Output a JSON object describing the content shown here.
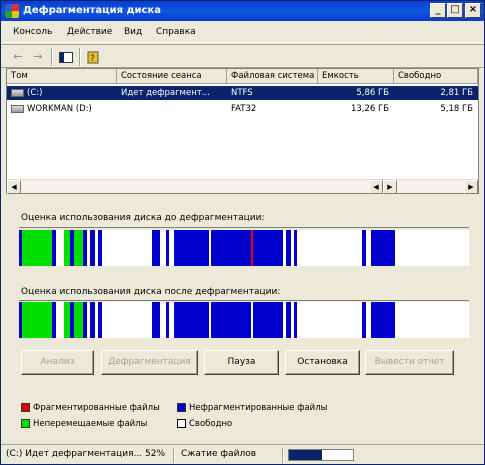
{
  "window": {
    "title": "Дефрагментация диска"
  },
  "menu": [
    "Консоль",
    "Действие",
    "Вид",
    "Справка"
  ],
  "toolbar": {
    "back_icon": "←",
    "forward_icon": "→"
  },
  "volumes": {
    "columns": [
      "Том",
      "Состояние сеанса",
      "Файловая система",
      "Емкость",
      "Свободно"
    ],
    "rows": [
      {
        "name": "(C:)",
        "status": "Идет дефрагмент...",
        "fs": "NTFS",
        "capacity": "5,86 ГБ",
        "free": "2,81 ГБ",
        "selected": true
      },
      {
        "name": "WORKMAN (D:)",
        "status": "",
        "fs": "FAT32",
        "capacity": "13,26 ГБ",
        "free": "5,18 ГБ",
        "selected": false
      }
    ]
  },
  "before_label": "Оценка использования диска до дефрагментации:",
  "after_label": "Оценка использования диска после дефрагментации:",
  "buttons": {
    "analyze": "Анализ",
    "defrag": "Дефрагментация",
    "pause": "Пауза",
    "stop": "Остановка",
    "report": "Вывести отчет"
  },
  "legend": {
    "fragmented": "Фрагментированные файлы",
    "contiguous": "Нефрагментированные файлы",
    "unmovable": "Неперемещаемые файлы",
    "free": "Свободно"
  },
  "colors": {
    "fragmented": "#e00000",
    "contiguous": "#0000cc",
    "unmovable": "#00dd00",
    "free": "#ffffff",
    "selected": "#0a246a"
  },
  "status": {
    "text": "(C:) Идет дефрагментация... 52%",
    "action": "Сжатие файлов",
    "progress": 0.52
  }
}
